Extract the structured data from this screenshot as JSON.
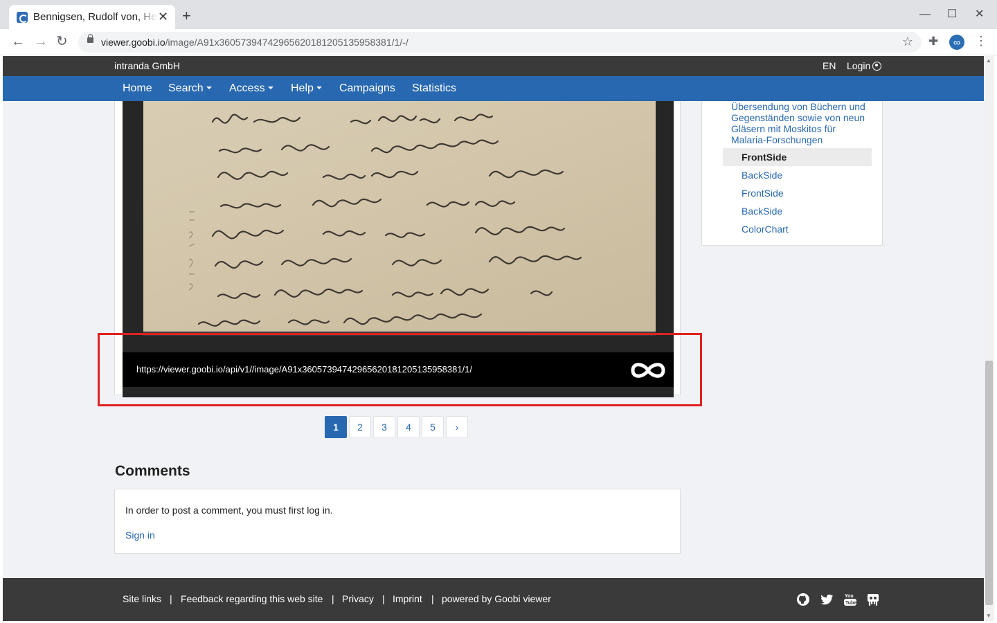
{
  "browser": {
    "tab_title": "Bennigsen, Rudolf von, Heinrich",
    "tab_close": "✕",
    "new_tab": "+",
    "url_host": "viewer.goobi.io",
    "url_path": "/image/A91x36057394742965620181205135958381/1/-/",
    "minimize": "—",
    "maximize": "☐",
    "close": "✕"
  },
  "site": {
    "brand": "intranda GmbH",
    "lang": "EN",
    "login": "Login"
  },
  "nav": {
    "items": [
      {
        "label": "Home",
        "dropdown": false
      },
      {
        "label": "Search",
        "dropdown": true
      },
      {
        "label": "Access",
        "dropdown": true
      },
      {
        "label": "Help",
        "dropdown": true
      },
      {
        "label": "Campaigns",
        "dropdown": false
      },
      {
        "label": "Statistics",
        "dropdown": false
      }
    ]
  },
  "viewer": {
    "caption_url": "https://viewer.goobi.io/api/v1//image/A91x36057394742965620181205135958381/1/",
    "license_icon": "creative-commons-zero-icon"
  },
  "pagination": {
    "pages": [
      "1",
      "2",
      "3",
      "4",
      "5"
    ],
    "active": "1",
    "next": "›"
  },
  "comments": {
    "heading": "Comments",
    "message": "In order to post a comment, you must first log in.",
    "signin": "Sign in"
  },
  "toc": {
    "parent": "Übersendung von Büchern und Gegenständen sowie von neun Gläsern mit Moskitos für Malaria-Forschungen",
    "items": [
      {
        "label": "FrontSide",
        "active": true
      },
      {
        "label": "BackSide",
        "active": false
      },
      {
        "label": "FrontSide",
        "active": false
      },
      {
        "label": "BackSide",
        "active": false
      },
      {
        "label": "ColorChart",
        "active": false
      }
    ]
  },
  "footer": {
    "links": [
      "Site links",
      "Feedback regarding this web site",
      "Privacy",
      "Imprint",
      "powered by Goobi viewer"
    ],
    "separator": "|",
    "social": [
      "github-icon",
      "twitter-icon",
      "youtube-icon",
      "slideshare-icon"
    ]
  },
  "colors": {
    "brand_blue": "#2868b0",
    "dark_bar": "#3a3a3a",
    "page_bg": "#f0f2f5",
    "highlight_red": "#e02020"
  }
}
